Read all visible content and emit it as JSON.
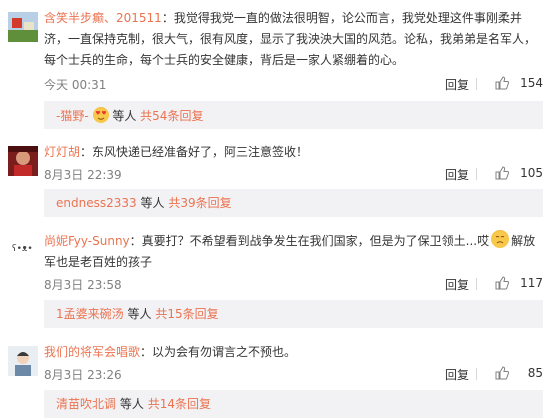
{
  "comments": [
    {
      "username": "含笑半步癫、201511",
      "text": "：我觉得我党一直的做法很明智，论公而言，我党处理这件事刚柔并济，一直保持克制，很大气，很有风度，显示了我泱泱大国的风范。论私，我弟弟是名军人，每个士兵的生命，每个士兵的安全健康，背后是一家人紧绷着的心。",
      "time": "今天 00:31",
      "reply_label": "回复",
      "likes": "154",
      "sub": {
        "names": "-猫野-",
        "suffix": "等人",
        "link": "共54条回复"
      }
    },
    {
      "username": "灯灯胡",
      "text": "：东风快递已经准备好了，阿三注意签收！",
      "time": "8月3日 22:39",
      "reply_label": "回复",
      "likes": "105",
      "sub": {
        "names": "endness2333",
        "suffix": "等人",
        "link": "共39条回复"
      }
    },
    {
      "username": "尚妮Fyy-Sunny",
      "text_a": "：真要打？不希望看到战争发生在我们国家，但是为了保卫领土...哎",
      "text_b": "解放军也是老百姓的孩子",
      "time": "8月3日 23:58",
      "reply_label": "回复",
      "likes": "117",
      "sub": {
        "names": "1孟婆来碗汤",
        "suffix": "等人",
        "link": "共15条回复"
      }
    },
    {
      "username": "我们的将军会唱歌",
      "text": "：以为会有勿谓言之不预也。",
      "time": "8月3日 23:26",
      "reply_label": "回复",
      "likes": "85",
      "sub": {
        "names": "清苗吹北调",
        "suffix": "等人",
        "link": "共14条回复"
      }
    }
  ],
  "colors": {
    "username": "#eb7350",
    "subbox_bg": "#f2f2f5",
    "meta": "#808080"
  },
  "icons": {
    "like": "thumbs-up-icon",
    "emoji_a": "hearts-face-emoji",
    "emoji_b": "sad-face-emoji"
  }
}
